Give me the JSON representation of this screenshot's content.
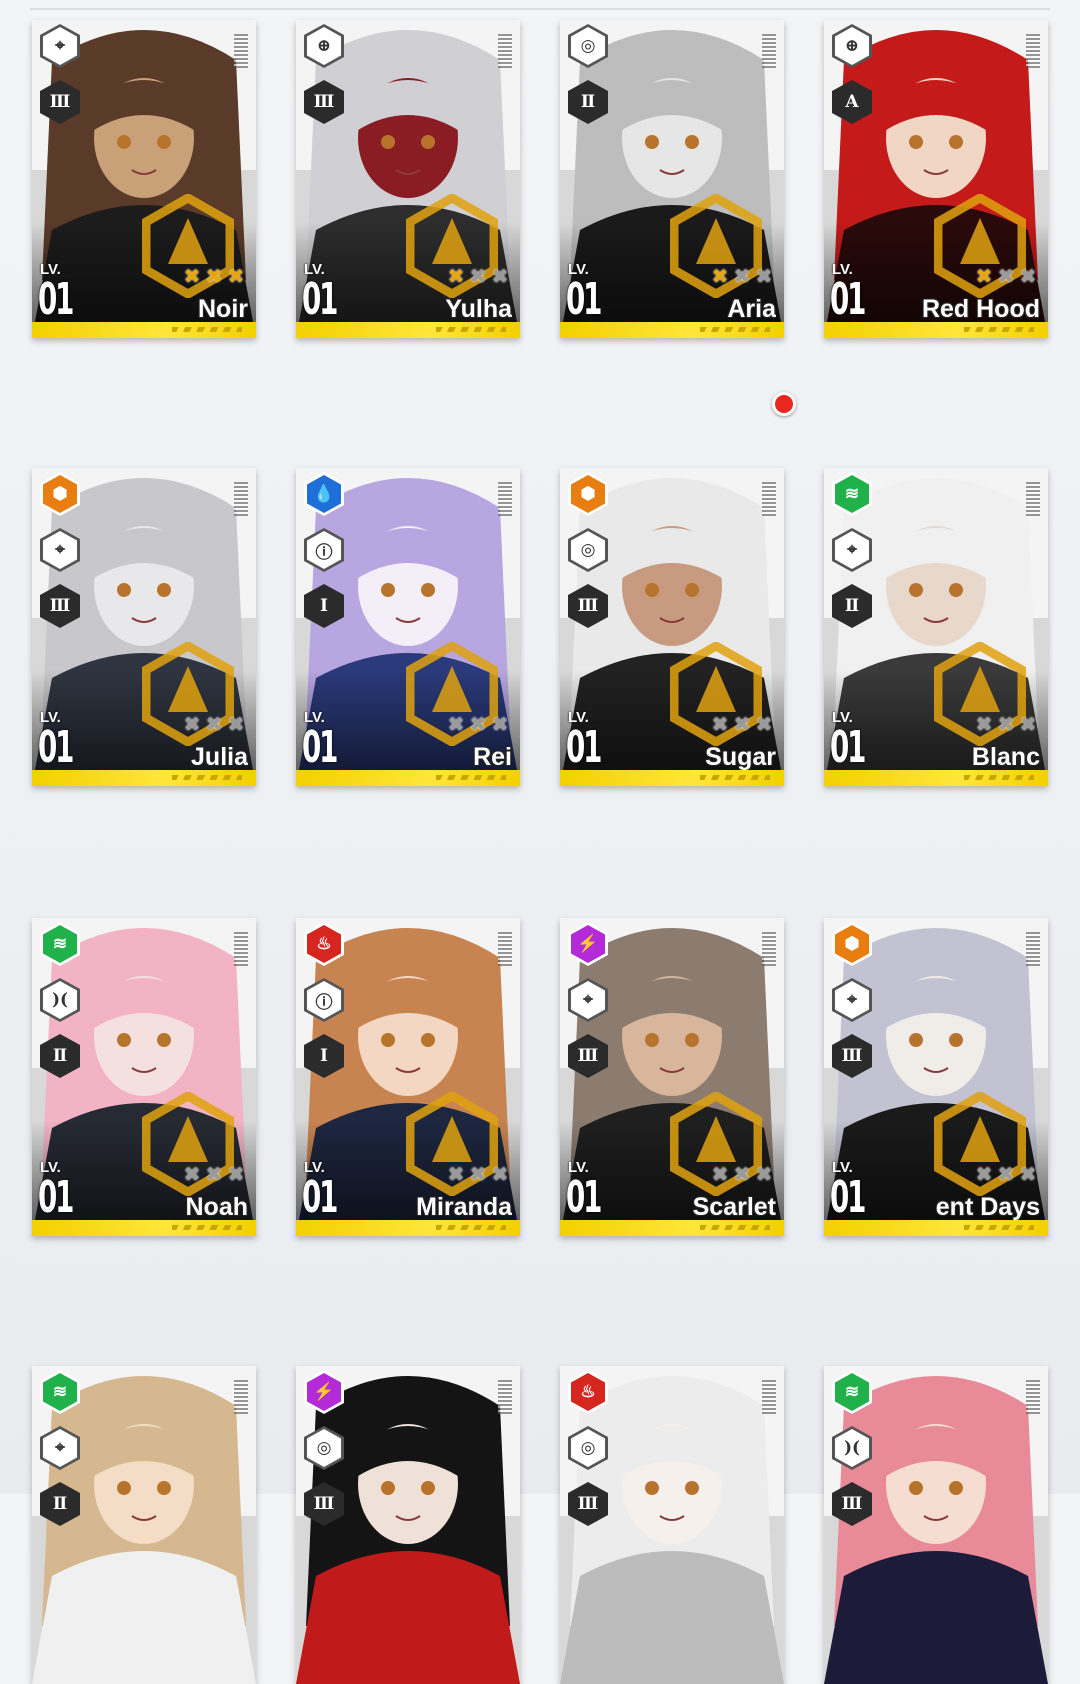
{
  "cards": [
    {
      "name": "Noir",
      "level": "01",
      "lv_label": "LV.",
      "stars": 3,
      "element": "",
      "class_icon": "crosshair-icon",
      "burst": "Ⅲ",
      "colors": [
        "#5a3a28",
        "#1c1c1c",
        "#c9a178"
      ]
    },
    {
      "name": "Yulha",
      "level": "01",
      "lv_label": "LV.",
      "stars": 1,
      "element": "",
      "class_icon": "scope-icon",
      "burst": "Ⅲ",
      "colors": [
        "#cfcfd4",
        "#2d2d2d",
        "#8a1c24"
      ]
    },
    {
      "name": "Aria",
      "level": "01",
      "lv_label": "LV.",
      "stars": 1,
      "element": "",
      "class_icon": "target-icon",
      "burst": "Ⅱ",
      "colors": [
        "#bdbdbd",
        "#1a1a1a",
        "#e6e6e6"
      ]
    },
    {
      "name": "Red Hood",
      "level": "01",
      "lv_label": "LV.",
      "stars": 1,
      "element": "",
      "class_icon": "scope-icon",
      "burst": "A",
      "colors": [
        "#c41a1a",
        "#2a0a0a",
        "#f1d6c6"
      ]
    },
    {
      "name": "Julia",
      "level": "01",
      "lv_label": "LV.",
      "stars": 0,
      "element": "iron",
      "class_icon": "crosshair-icon",
      "burst": "Ⅲ",
      "colors": [
        "#c7c7cc",
        "#2f3540",
        "#e8e8ea"
      ]
    },
    {
      "name": "Rei",
      "level": "01",
      "lv_label": "LV.",
      "stars": 0,
      "element": "water",
      "class_icon": "pistol-icon",
      "burst": "Ⅰ",
      "colors": [
        "#b7a6e0",
        "#2a3a7a",
        "#f3eef8"
      ]
    },
    {
      "name": "Sugar",
      "level": "01",
      "lv_label": "LV.",
      "stars": 0,
      "element": "iron",
      "class_icon": "target-icon",
      "burst": "Ⅲ",
      "colors": [
        "#e9e9e9",
        "#222222",
        "#c89a80"
      ]
    },
    {
      "name": "Blanc",
      "level": "01",
      "lv_label": "LV.",
      "stars": 0,
      "element": "wind",
      "class_icon": "crosshair-icon",
      "burst": "Ⅱ",
      "colors": [
        "#f0f0f0",
        "#3a3a3a",
        "#e8d8cc"
      ]
    },
    {
      "name": "Noah",
      "level": "01",
      "lv_label": "LV.",
      "stars": 0,
      "element": "wind",
      "class_icon": "spread-icon",
      "burst": "Ⅱ",
      "colors": [
        "#f2b4c4",
        "#262a33",
        "#f5e0e0"
      ]
    },
    {
      "name": "Miranda",
      "level": "01",
      "lv_label": "LV.",
      "stars": 0,
      "element": "fire",
      "class_icon": "pistol-icon",
      "burst": "Ⅰ",
      "colors": [
        "#c88450",
        "#1e2740",
        "#f3d7c3"
      ]
    },
    {
      "name": "Scarlet",
      "level": "01",
      "lv_label": "LV.",
      "stars": 0,
      "element": "electric",
      "class_icon": "crosshair-icon",
      "burst": "Ⅲ",
      "colors": [
        "#8c7c70",
        "#1f1f1f",
        "#d8b69c"
      ]
    },
    {
      "name": "ent Days",
      "level": "01",
      "lv_label": "LV.",
      "stars": 0,
      "element": "iron",
      "class_icon": "crosshair-icon",
      "burst": "Ⅲ",
      "colors": [
        "#c2c2d2",
        "#1a1a1a",
        "#f0ece8"
      ]
    },
    {
      "name": "",
      "level": "",
      "lv_label": "",
      "stars": -1,
      "element": "wind",
      "class_icon": "crosshair-icon",
      "burst": "Ⅱ",
      "colors": [
        "#d6b890",
        "#f0f0f0",
        "#f3ddc6"
      ]
    },
    {
      "name": "",
      "level": "",
      "lv_label": "",
      "stars": -1,
      "element": "electric",
      "class_icon": "target-icon",
      "burst": "Ⅲ",
      "colors": [
        "#141414",
        "#c01a1a",
        "#efe0d8"
      ]
    },
    {
      "name": "",
      "level": "",
      "lv_label": "",
      "stars": -1,
      "element": "fire",
      "class_icon": "target-icon",
      "burst": "Ⅲ",
      "colors": [
        "#ececec",
        "#bcbcbc",
        "#f6f0ec"
      ]
    },
    {
      "name": "",
      "level": "",
      "lv_label": "",
      "stars": -1,
      "element": "wind",
      "class_icon": "spread-icon",
      "burst": "Ⅲ",
      "colors": [
        "#e88a98",
        "#1c1c3a",
        "#f5ddd3"
      ]
    }
  ]
}
